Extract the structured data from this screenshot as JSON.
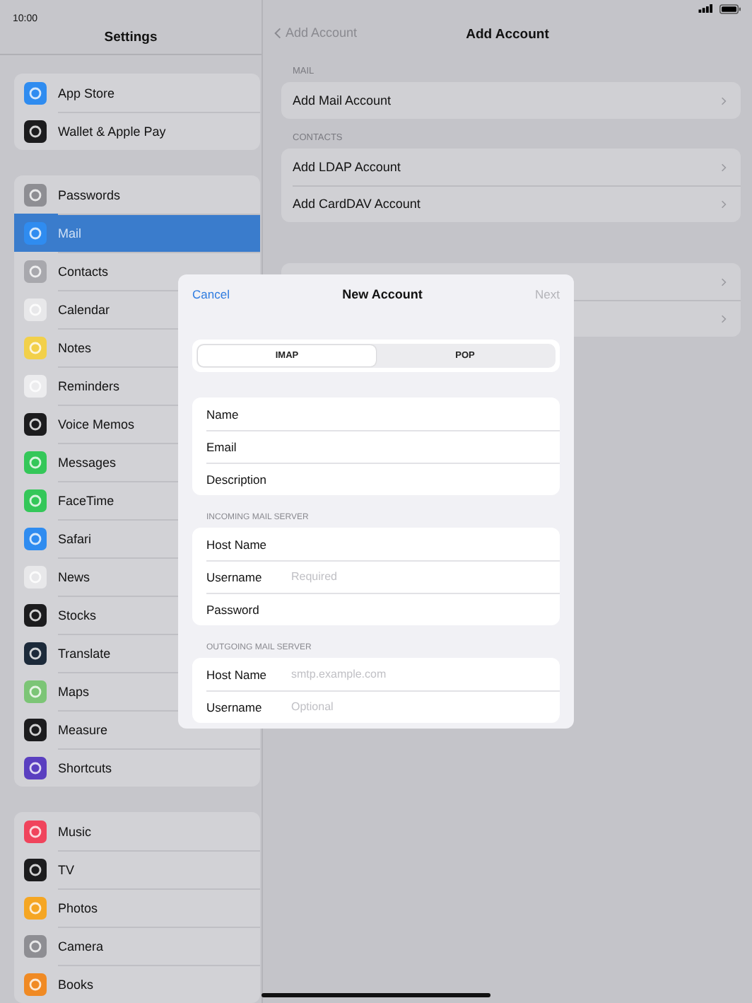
{
  "status_bar": {
    "time": "10:00"
  },
  "sidebar": {
    "title": "Settings",
    "groups": [
      [
        {
          "label": "App Store",
          "color": "#2f8cf0",
          "selected": false
        },
        {
          "label": "Wallet & Apple Pay",
          "color": "#1c1c1e",
          "selected": false
        }
      ],
      [
        {
          "label": "Passwords",
          "color": "#8e8e93",
          "selected": false
        },
        {
          "label": "Mail",
          "color": "#2f8cf0",
          "selected": true
        },
        {
          "label": "Contacts",
          "color": "#a8a8ad",
          "selected": false
        },
        {
          "label": "Calendar",
          "color": "#e8e8ea",
          "selected": false
        },
        {
          "label": "Notes",
          "color": "#f2d04a",
          "selected": false
        },
        {
          "label": "Reminders",
          "color": "#ececee",
          "selected": false
        },
        {
          "label": "Voice Memos",
          "color": "#1c1c1e",
          "selected": false
        },
        {
          "label": "Messages",
          "color": "#34c759",
          "selected": false
        },
        {
          "label": "FaceTime",
          "color": "#34c759",
          "selected": false
        },
        {
          "label": "Safari",
          "color": "#2f8cf0",
          "selected": false
        },
        {
          "label": "News",
          "color": "#e8e8ea",
          "selected": false
        },
        {
          "label": "Stocks",
          "color": "#1c1c1e",
          "selected": false
        },
        {
          "label": "Translate",
          "color": "#1c2a3a",
          "selected": false
        },
        {
          "label": "Maps",
          "color": "#7cc576",
          "selected": false
        },
        {
          "label": "Measure",
          "color": "#1c1c1e",
          "selected": false
        },
        {
          "label": "Shortcuts",
          "color": "#5a3fc0",
          "selected": false
        }
      ],
      [
        {
          "label": "Music",
          "color": "#f0445c",
          "selected": false
        },
        {
          "label": "TV",
          "color": "#1c1c1e",
          "selected": false
        },
        {
          "label": "Photos",
          "color": "#f5a623",
          "selected": false
        },
        {
          "label": "Camera",
          "color": "#8e8e93",
          "selected": false
        },
        {
          "label": "Books",
          "color": "#f08a24",
          "selected": false
        }
      ]
    ]
  },
  "detail": {
    "back": "Add Account",
    "title": "Add Account",
    "sections": [
      {
        "header": "MAIL",
        "rows": [
          "Add Mail Account"
        ]
      },
      {
        "header": "CONTACTS",
        "rows": [
          "Add LDAP Account",
          "Add CardDAV Account"
        ]
      }
    ]
  },
  "dialog": {
    "cancel": "Cancel",
    "title": "New Account",
    "next": {
      "label": "Next",
      "disabled": true
    },
    "segments": [
      {
        "label": "IMAP",
        "selected": true
      },
      {
        "label": "POP",
        "selected": false
      }
    ],
    "groups": [
      {
        "fields": [
          {
            "label": "Name"
          },
          {
            "label": "Email"
          },
          {
            "label": "Description"
          }
        ]
      },
      {
        "header": "INCOMING MAIL SERVER",
        "fields": [
          {
            "label": "Host Name"
          },
          {
            "label": "Username",
            "placeholder": "Required"
          },
          {
            "label": "Password"
          }
        ]
      },
      {
        "header": "OUTGOING MAIL SERVER",
        "fields": [
          {
            "label": "Host Name",
            "placeholder": "smtp.example.com"
          },
          {
            "label": "Username",
            "placeholder": "Optional"
          }
        ]
      }
    ]
  }
}
